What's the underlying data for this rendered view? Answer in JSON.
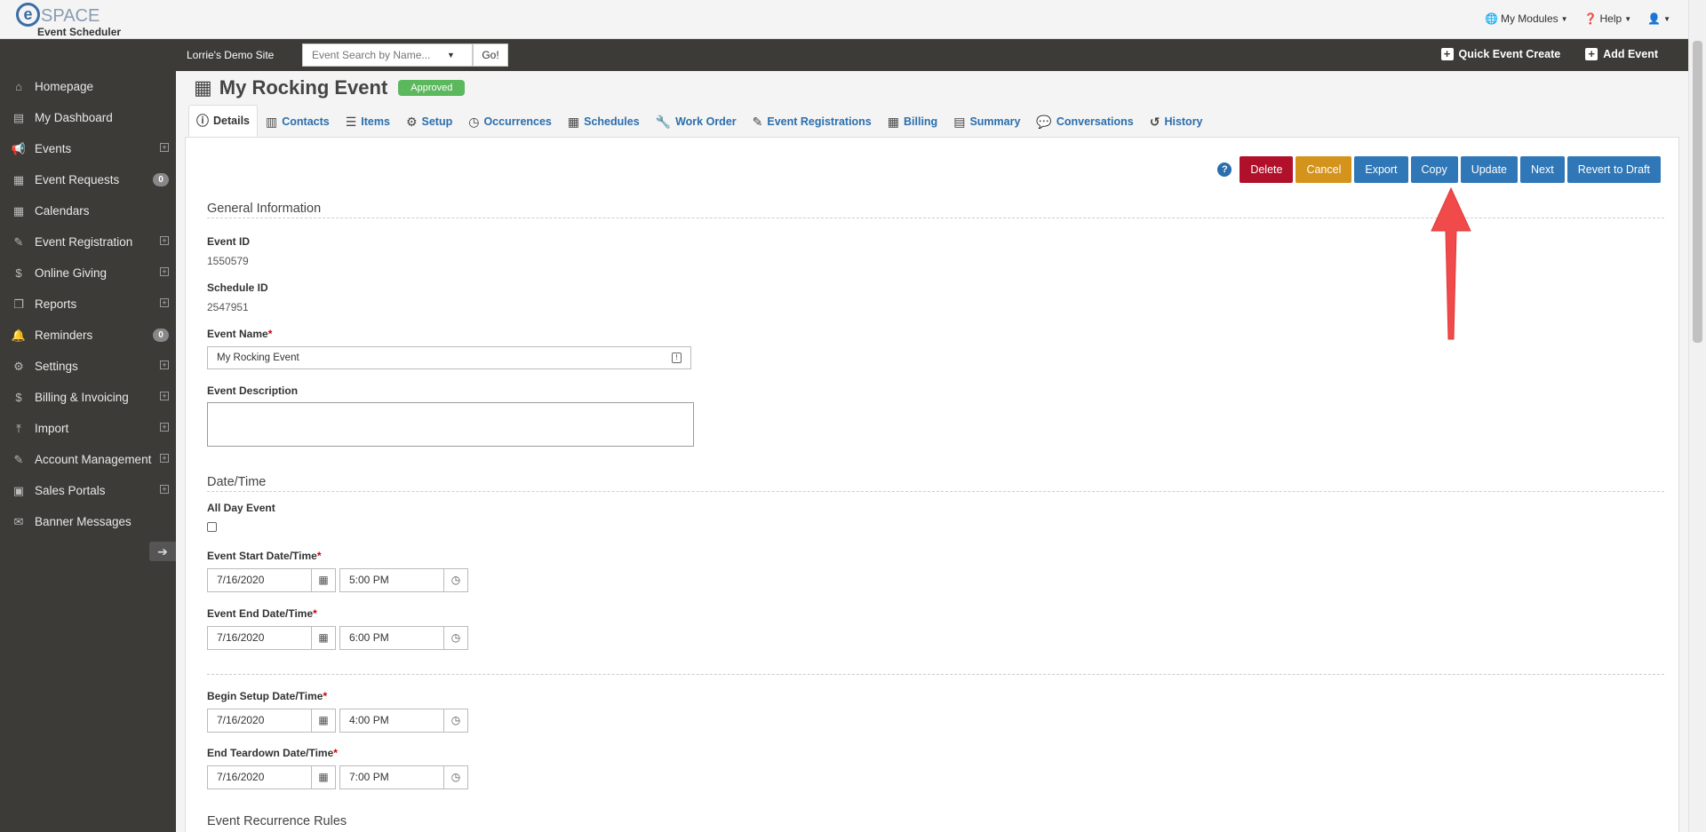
{
  "brand": {
    "logo_letter": "e",
    "logo_text": "SPACE",
    "app_name": "Event Scheduler"
  },
  "top_menu": {
    "modules": "My Modules",
    "help": "Help",
    "user": ""
  },
  "site_bar": {
    "site_name": "Lorrie's Demo Site",
    "search_placeholder": "Event Search by Name...",
    "go_label": "Go!",
    "quick_create": "Quick Event Create",
    "add_event": "Add Event"
  },
  "sidebar": {
    "items": [
      {
        "label": "Homepage",
        "icon": "home-icon",
        "glyph": "⌂",
        "expandable": false,
        "badge": ""
      },
      {
        "label": "My Dashboard",
        "icon": "dashboard-icon",
        "glyph": "▤",
        "expandable": false,
        "badge": ""
      },
      {
        "label": "Events",
        "icon": "megaphone-icon",
        "glyph": "📢",
        "expandable": true,
        "badge": ""
      },
      {
        "label": "Event Requests",
        "icon": "calendar-icon",
        "glyph": "▦",
        "expandable": false,
        "badge": "0"
      },
      {
        "label": "Calendars",
        "icon": "calendar-icon",
        "glyph": "▦",
        "expandable": false,
        "badge": ""
      },
      {
        "label": "Event Registration",
        "icon": "ticket-icon",
        "glyph": "✎",
        "expandable": true,
        "badge": ""
      },
      {
        "label": "Online Giving",
        "icon": "dollar-icon",
        "glyph": "$",
        "expandable": true,
        "badge": ""
      },
      {
        "label": "Reports",
        "icon": "copy-icon",
        "glyph": "❐",
        "expandable": true,
        "badge": ""
      },
      {
        "label": "Reminders",
        "icon": "bell-icon",
        "glyph": "🔔",
        "expandable": false,
        "badge": "0"
      },
      {
        "label": "Settings",
        "icon": "gear-icon",
        "glyph": "⚙",
        "expandable": true,
        "badge": ""
      },
      {
        "label": "Billing & Invoicing",
        "icon": "dollar-icon",
        "glyph": "$",
        "expandable": true,
        "badge": ""
      },
      {
        "label": "Import",
        "icon": "upload-icon",
        "glyph": "⤒",
        "expandable": true,
        "badge": ""
      },
      {
        "label": "Account Management",
        "icon": "pencil-icon",
        "glyph": "✎",
        "expandable": true,
        "badge": ""
      },
      {
        "label": "Sales Portals",
        "icon": "money-icon",
        "glyph": "▣",
        "expandable": true,
        "badge": ""
      },
      {
        "label": "Banner Messages",
        "icon": "envelope-icon",
        "glyph": "✉",
        "expandable": false,
        "badge": ""
      }
    ]
  },
  "page": {
    "title": "My Rocking Event",
    "status": "Approved"
  },
  "tabs": [
    {
      "label": "Details",
      "icon": "info-icon",
      "glyph": "ⓘ",
      "active": true
    },
    {
      "label": "Contacts",
      "icon": "contacts-icon",
      "glyph": "▥",
      "active": false
    },
    {
      "label": "Items",
      "icon": "list-icon",
      "glyph": "☰",
      "active": false
    },
    {
      "label": "Setup",
      "icon": "gears-icon",
      "glyph": "⚙",
      "active": false
    },
    {
      "label": "Occurrences",
      "icon": "clock-check-icon",
      "glyph": "◷",
      "active": false
    },
    {
      "label": "Schedules",
      "icon": "calendar-icon",
      "glyph": "▦",
      "active": false
    },
    {
      "label": "Work Order",
      "icon": "wrench-icon",
      "glyph": "🔧",
      "active": false
    },
    {
      "label": "Event Registrations",
      "icon": "ticket-icon",
      "glyph": "✎",
      "active": false
    },
    {
      "label": "Billing",
      "icon": "billing-calendar-icon",
      "glyph": "▦",
      "active": false
    },
    {
      "label": "Summary",
      "icon": "document-icon",
      "glyph": "▤",
      "active": false
    },
    {
      "label": "Conversations",
      "icon": "chat-icon",
      "glyph": "💬",
      "active": false
    },
    {
      "label": "History",
      "icon": "history-icon",
      "glyph": "↺",
      "active": false
    }
  ],
  "actions": {
    "help": "?",
    "delete": "Delete",
    "cancel": "Cancel",
    "export": "Export",
    "copy": "Copy",
    "update": "Update",
    "next": "Next",
    "revert": "Revert to Draft"
  },
  "colors": {
    "delete": "#b0102a",
    "cancel": "#d4941c",
    "primary": "#2f77b6",
    "sidebar": "#3d3b38",
    "approved": "#5cb85c",
    "arrow": "#f04a4a"
  },
  "form": {
    "general_title": "General Information",
    "event_id_label": "Event ID",
    "event_id": "1550579",
    "schedule_id_label": "Schedule ID",
    "schedule_id": "2547951",
    "event_name_label": "Event Name",
    "event_name": "My Rocking Event",
    "event_description_label": "Event Description",
    "event_description": "",
    "datetime_title": "Date/Time",
    "all_day_label": "All Day Event",
    "all_day": false,
    "start_label": "Event Start Date/Time",
    "start_date": "7/16/2020",
    "start_time": "5:00 PM",
    "end_label": "Event End Date/Time",
    "end_date": "7/16/2020",
    "end_time": "6:00 PM",
    "setup_label": "Begin Setup Date/Time",
    "setup_date": "7/16/2020",
    "setup_time": "4:00 PM",
    "teardown_label": "End Teardown Date/Time",
    "teardown_date": "7/16/2020",
    "teardown_time": "7:00 PM",
    "recurrence_title": "Event Recurrence Rules",
    "required_marker": "*"
  }
}
